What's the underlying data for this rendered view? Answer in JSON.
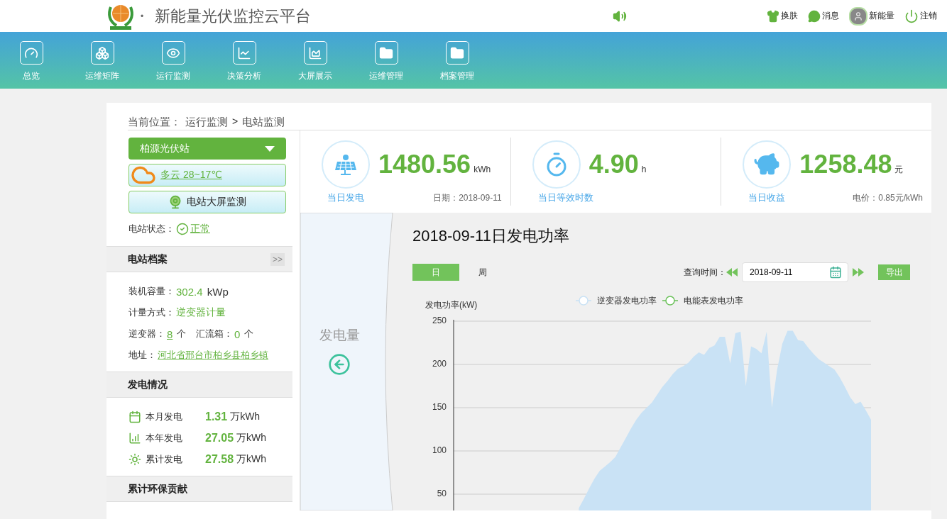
{
  "header": {
    "separator": "•",
    "title": "新能量光伏监控云平台",
    "actions": [
      {
        "kind": "skin",
        "label": "换肤"
      },
      {
        "kind": "message",
        "label": "消息"
      },
      {
        "kind": "user",
        "label": "新能量"
      },
      {
        "kind": "logout",
        "label": "注销"
      }
    ]
  },
  "nav": {
    "items": [
      {
        "kind": "gauge",
        "label": "总览"
      },
      {
        "kind": "boxes",
        "label": "运维矩阵"
      },
      {
        "kind": "eye",
        "label": "运行监测"
      },
      {
        "kind": "analysis",
        "label": "决策分析"
      },
      {
        "kind": "area",
        "label": "大屏展示"
      },
      {
        "kind": "folder",
        "label": "运维管理"
      },
      {
        "kind": "folder",
        "label": "档案管理"
      }
    ]
  },
  "breadcrumb": {
    "prefix": "当前位置：",
    "items": [
      "运行监测",
      "电站监测"
    ],
    "separator": ">"
  },
  "sidebar": {
    "station": "柏源光伏站",
    "weather": "多云   28~17℃",
    "big_screen_button": "电站大屏监测",
    "status": {
      "label": "电站状态：",
      "value": "正常"
    },
    "archive": {
      "title": "电站档案",
      "toggle": ">>",
      "capacity": {
        "label": "装机容量：",
        "value": "302.4",
        "unit": "kWp"
      },
      "metering": {
        "label": "计量方式：",
        "value": "逆变器计量"
      },
      "inverters": {
        "label": "逆变器：",
        "value": "8",
        "unit": "个"
      },
      "combiners": {
        "label": "汇流箱：",
        "value": "0",
        "unit": "个"
      },
      "address": {
        "label": "地址：",
        "value": "河北省邢台市柏乡县柏乡镇"
      }
    },
    "generation": {
      "title": "发电情况",
      "rows": [
        {
          "kind": "calendar",
          "label": "本月发电",
          "value": "1.31",
          "unit": "万kWh"
        },
        {
          "kind": "trend",
          "label": "本年发电",
          "value": "27.05",
          "unit": "万kWh"
        },
        {
          "kind": "sun",
          "label": "累计发电",
          "value": "27.58",
          "unit": "万kWh"
        }
      ]
    },
    "eco": {
      "title": "累计环保贡献"
    }
  },
  "stats": [
    {
      "kind": "solar",
      "value": "1480.56",
      "unit": "kWh",
      "label": "当日发电",
      "note": "日期：2018-09-11"
    },
    {
      "kind": "timer",
      "value": "4.90",
      "unit": "h",
      "label": "当日等效时数"
    },
    {
      "kind": "piggy",
      "value": "1258.48",
      "unit": "元",
      "label": "当日收益",
      "note": "电价：0.85元/kWh"
    }
  ],
  "side_tab": {
    "label": "发电量"
  },
  "power": {
    "title": "2018-09-11日发电功率",
    "tabs": [
      {
        "label": "日",
        "selected": true
      },
      {
        "label": "周",
        "selected": false
      }
    ],
    "query_label": "查询时间：",
    "date": "2018-09-11",
    "export": "导出",
    "chart_data": {
      "type": "area",
      "ylabel": "发电功率(kW)",
      "ylim": [
        0,
        250
      ],
      "grid": true,
      "yticks": [
        50,
        100,
        150,
        200,
        250
      ],
      "categories": [
        null,
        null,
        null,
        null,
        null,
        null,
        null,
        null,
        null,
        null,
        null,
        null,
        null,
        null,
        null,
        null,
        null,
        null,
        null,
        null,
        null,
        null,
        null,
        null,
        null,
        null,
        null,
        null,
        null,
        null,
        null,
        null,
        null,
        null,
        null,
        null,
        null,
        null,
        null,
        null,
        null,
        null,
        null,
        null,
        null,
        null,
        null,
        null,
        null,
        null,
        null,
        null,
        null,
        null,
        null,
        null,
        null,
        null,
        null,
        null,
        null,
        null,
        null,
        null,
        null,
        null,
        null,
        null,
        null,
        null,
        null,
        null,
        null,
        null,
        null,
        null,
        null,
        null,
        null,
        null,
        null
      ],
      "series": [
        {
          "name": "逆变器发电功率",
          "color": "#c9e2f5",
          "values": [
            null,
            null,
            null,
            null,
            null,
            null,
            null,
            null,
            null,
            null,
            null,
            null,
            null,
            null,
            null,
            null,
            null,
            null,
            null,
            null,
            null,
            null,
            null,
            null,
            34,
            45,
            57,
            68,
            77,
            82,
            87,
            93,
            104,
            115,
            126,
            136,
            144,
            150,
            156,
            165,
            174,
            181,
            189,
            195,
            198,
            202,
            209,
            214,
            211,
            219,
            222,
            232,
            232,
            201,
            236,
            238,
            175,
            221,
            218,
            213,
            238,
            150,
            194,
            224,
            239,
            239,
            228,
            227,
            219,
            212,
            206,
            202,
            198,
            194,
            185,
            174,
            162,
            154,
            157,
            147,
            136
          ]
        },
        {
          "name": "电能表发电功率",
          "color": "#6ac159",
          "values": [
            null,
            null,
            null,
            null,
            null,
            null,
            null,
            null,
            null,
            null,
            null,
            null,
            null,
            null,
            null,
            null,
            null,
            null,
            null,
            null,
            null,
            null,
            null,
            null,
            null,
            null,
            null,
            null,
            null,
            null,
            null,
            null,
            null,
            null,
            null,
            null,
            null,
            null,
            null,
            null,
            null,
            null,
            null,
            null,
            null,
            null,
            null,
            null,
            null,
            null,
            null,
            null,
            null,
            null,
            null,
            null,
            null,
            null,
            null,
            null,
            null,
            null,
            null,
            null,
            null,
            null,
            null,
            null,
            null,
            null,
            null,
            null,
            null,
            null,
            null,
            null,
            null,
            null,
            null,
            null,
            null
          ]
        }
      ]
    }
  }
}
